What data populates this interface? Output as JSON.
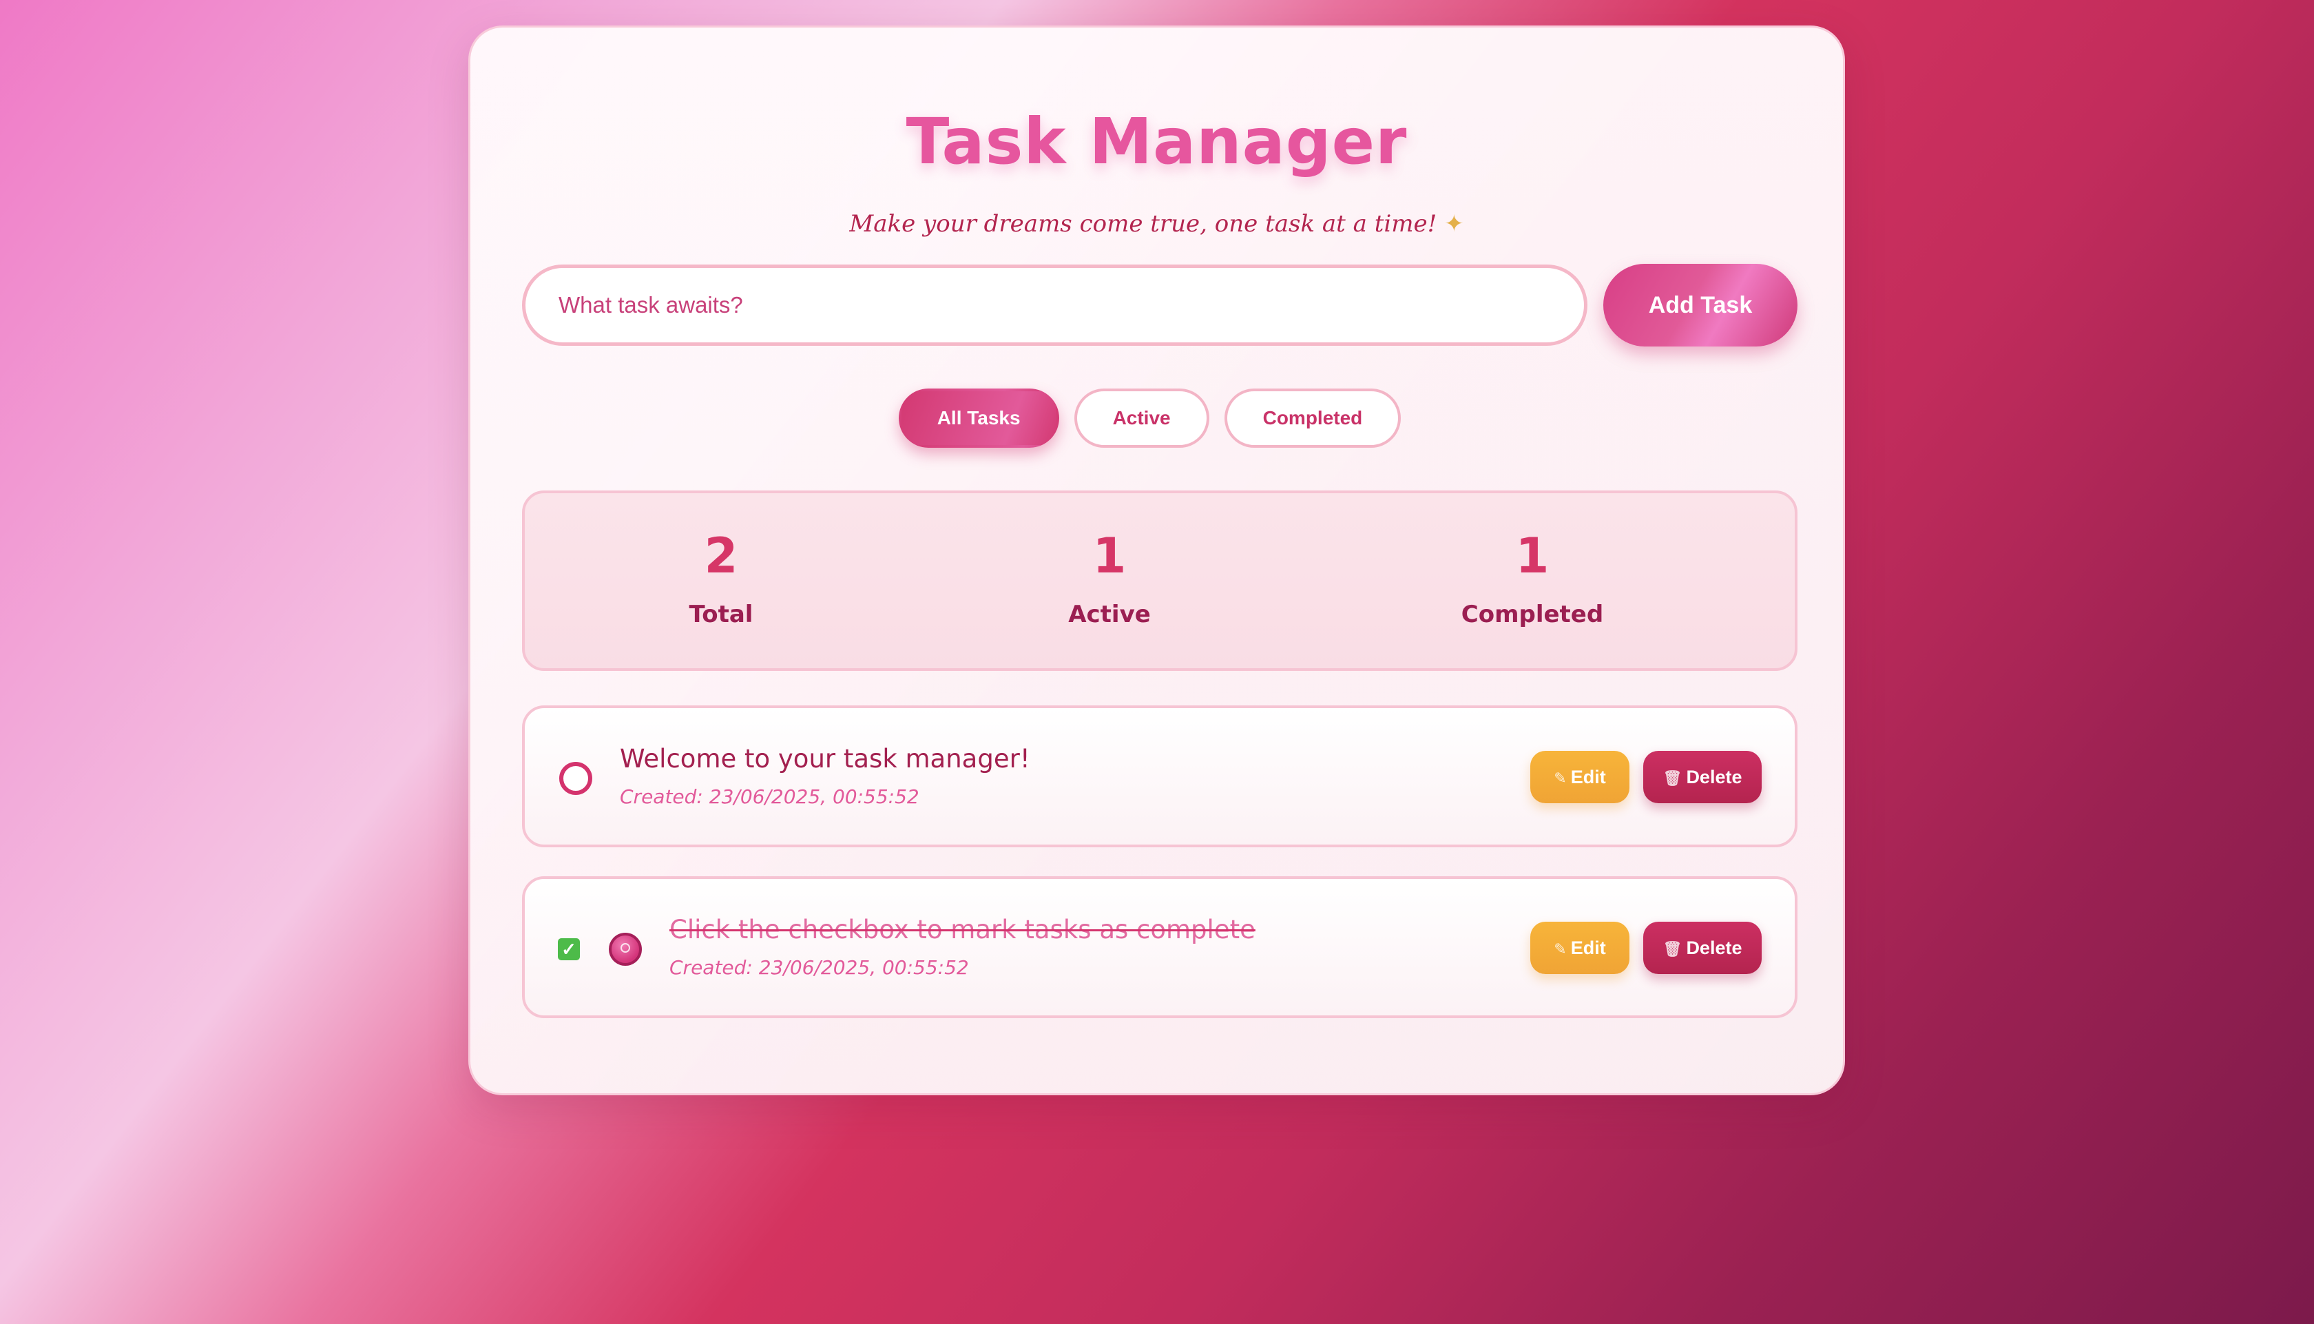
{
  "app": {
    "title": "Task Manager",
    "subtitle": "Make your dreams come true, one task at a time!",
    "subtitle_icon": "✦"
  },
  "input": {
    "placeholder": "What task awaits?",
    "value": "",
    "add_label": "Add Task"
  },
  "filters": [
    {
      "label": "All Tasks",
      "active": true
    },
    {
      "label": "Active",
      "active": false
    },
    {
      "label": "Completed",
      "active": false
    }
  ],
  "stats": [
    {
      "value": "2",
      "label": "Total"
    },
    {
      "value": "1",
      "label": "Active"
    },
    {
      "value": "1",
      "label": "Completed"
    }
  ],
  "tasks": [
    {
      "text": "Welcome to your task manager!",
      "created": "Created: 23/06/2025, 00:55:52",
      "completed": false,
      "edit_label": "Edit",
      "delete_label": "Delete"
    },
    {
      "text": "Click the checkbox to mark tasks as complete",
      "created": "Created: 23/06/2025, 00:55:52",
      "completed": true,
      "edit_label": "Edit",
      "delete_label": "Delete"
    }
  ],
  "icons": {
    "edit": "pencil-icon",
    "delete": "trash-icon",
    "check": "checkbox-checked-icon"
  },
  "colors": {
    "accent": "#e6569e",
    "primary_dark": "#a3204f",
    "edit": "#f5ad38",
    "delete": "#c42a5a",
    "check": "#4dbb49"
  }
}
